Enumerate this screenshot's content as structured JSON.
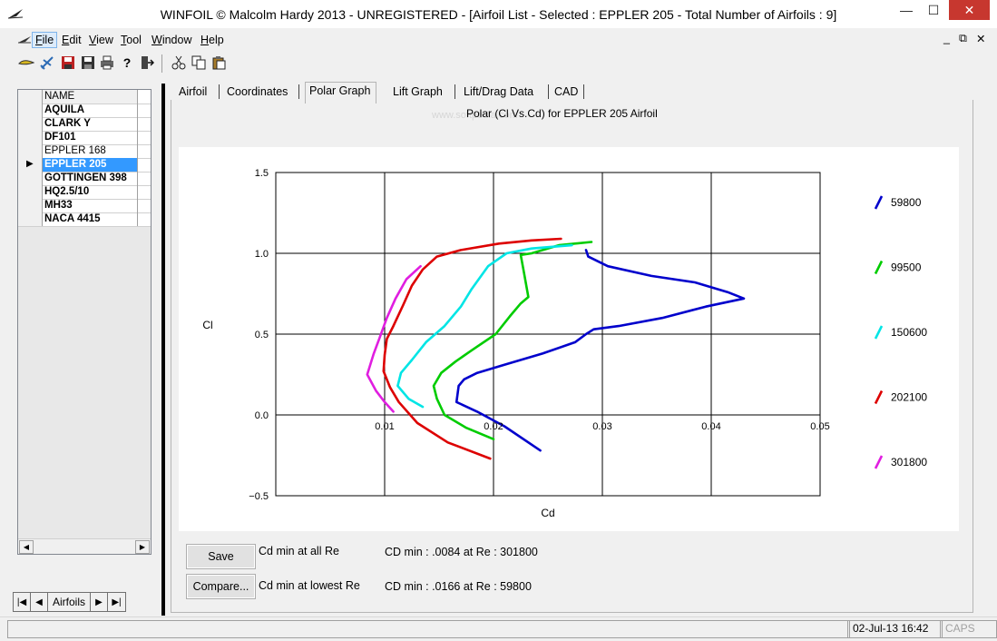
{
  "window": {
    "title": "WINFOIL © Malcolm Hardy 2013 - UNREGISTERED - [Airfoil List - Selected : EPPLER 205 - Total Number of Airfoils : 9]",
    "minimize": "—",
    "maximize": "☐",
    "close": "✕",
    "mdi_minimize": "_",
    "mdi_restore": "⧉",
    "mdi_close": "✕"
  },
  "menu": [
    {
      "label": "File",
      "key": "F"
    },
    {
      "label": "Edit",
      "key": "E"
    },
    {
      "label": "View",
      "key": "V"
    },
    {
      "label": "Tool",
      "key": "T"
    },
    {
      "label": "Window",
      "key": "W"
    },
    {
      "label": "Help",
      "key": "H"
    }
  ],
  "toolbar_icons": [
    "airfoil-icon",
    "aircraft-icon",
    "save-icon",
    "save-as-icon",
    "print-icon",
    "help-icon",
    "exit-icon",
    "cut-icon",
    "copy-icon",
    "paste-icon"
  ],
  "airfoil_list": {
    "header": "NAME",
    "items": [
      "AQUILA",
      "CLARK Y",
      "DF101",
      "EPPLER 168",
      "EPPLER 205",
      "GOTTINGEN 398",
      "HQ2.5/10",
      "MH33",
      "NACA 4415"
    ],
    "selected": "EPPLER 205",
    "selected_marker": "▶",
    "scroll_left": "◀",
    "scroll_right": "▶"
  },
  "navigator": {
    "first": "|◀",
    "prev": "◀",
    "label": "Airfoils",
    "next": "▶",
    "last": "▶|"
  },
  "tabs": [
    "Airfoil",
    "Coordinates",
    "Polar Graph",
    "Lift Graph",
    "Lift/Drag Data",
    "CAD"
  ],
  "active_tab": "Polar Graph",
  "watermark": "www.softpedia.com",
  "chart_data": {
    "type": "line",
    "title": "Polar (Cl Vs.Cd)  for EPPLER 205 Airfoil",
    "xlabel": "Cd",
    "ylabel": "Cl",
    "xlim": [
      0,
      0.05
    ],
    "ylim": [
      -0.5,
      1.5
    ],
    "xticks": [
      "0.01",
      "0.02",
      "0.03",
      "0.04",
      "0.05"
    ],
    "yticks": [
      "1.5",
      "1.0",
      "0.5",
      "0.0",
      "−0.5"
    ],
    "xtick_values": [
      0.01,
      0.02,
      0.03,
      0.04,
      0.05
    ],
    "ytick_values": [
      1.5,
      1.0,
      0.5,
      0.0,
      -0.5
    ],
    "grid": true,
    "legend_position": "right",
    "series": [
      {
        "name": "59800",
        "color": "#0000cc",
        "points": [
          [
            0.0285,
            1.02
          ],
          [
            0.0287,
            0.98
          ],
          [
            0.0305,
            0.92
          ],
          [
            0.0345,
            0.86
          ],
          [
            0.0385,
            0.82
          ],
          [
            0.0415,
            0.76
          ],
          [
            0.043,
            0.72
          ],
          [
            0.0395,
            0.67
          ],
          [
            0.0355,
            0.6
          ],
          [
            0.0315,
            0.55
          ],
          [
            0.0292,
            0.53
          ],
          [
            0.0285,
            0.5
          ],
          [
            0.0275,
            0.45
          ],
          [
            0.0245,
            0.38
          ],
          [
            0.021,
            0.31
          ],
          [
            0.0185,
            0.26
          ],
          [
            0.0173,
            0.22
          ],
          [
            0.0168,
            0.18
          ],
          [
            0.0166,
            0.08
          ],
          [
            0.0185,
            0.02
          ],
          [
            0.021,
            -0.07
          ],
          [
            0.0243,
            -0.22
          ]
        ]
      },
      {
        "name": "99500",
        "color": "#00cc00",
        "points": [
          [
            0.029,
            1.07
          ],
          [
            0.026,
            1.05
          ],
          [
            0.0235,
            1.0
          ],
          [
            0.0225,
            0.99
          ],
          [
            0.0228,
            0.88
          ],
          [
            0.0232,
            0.73
          ],
          [
            0.0225,
            0.69
          ],
          [
            0.0215,
            0.61
          ],
          [
            0.0202,
            0.5
          ],
          [
            0.018,
            0.4
          ],
          [
            0.0165,
            0.33
          ],
          [
            0.0152,
            0.26
          ],
          [
            0.0145,
            0.18
          ],
          [
            0.0148,
            0.1
          ],
          [
            0.0155,
            0.0
          ],
          [
            0.0175,
            -0.08
          ],
          [
            0.02,
            -0.15
          ]
        ]
      },
      {
        "name": "150600",
        "color": "#00e5e5",
        "points": [
          [
            0.0272,
            1.05
          ],
          [
            0.0235,
            1.03
          ],
          [
            0.0212,
            1.0
          ],
          [
            0.0195,
            0.92
          ],
          [
            0.018,
            0.78
          ],
          [
            0.017,
            0.67
          ],
          [
            0.0155,
            0.55
          ],
          [
            0.0138,
            0.45
          ],
          [
            0.0125,
            0.34
          ],
          [
            0.0115,
            0.26
          ],
          [
            0.0112,
            0.18
          ],
          [
            0.0122,
            0.1
          ],
          [
            0.0135,
            0.05
          ]
        ]
      },
      {
        "name": "202100",
        "color": "#dd0000",
        "points": [
          [
            0.0262,
            1.09
          ],
          [
            0.0235,
            1.08
          ],
          [
            0.0205,
            1.06
          ],
          [
            0.017,
            1.02
          ],
          [
            0.0148,
            0.98
          ],
          [
            0.0135,
            0.9
          ],
          [
            0.0125,
            0.8
          ],
          [
            0.0117,
            0.68
          ],
          [
            0.0108,
            0.55
          ],
          [
            0.0102,
            0.47
          ],
          [
            0.01,
            0.37
          ],
          [
            0.0099,
            0.27
          ],
          [
            0.0105,
            0.17
          ],
          [
            0.0113,
            0.08
          ],
          [
            0.013,
            -0.05
          ],
          [
            0.0158,
            -0.17
          ],
          [
            0.0197,
            -0.27
          ]
        ]
      },
      {
        "name": "301800",
        "color": "#e01ee0",
        "points": [
          [
            0.0133,
            0.92
          ],
          [
            0.012,
            0.84
          ],
          [
            0.011,
            0.72
          ],
          [
            0.0102,
            0.6
          ],
          [
            0.0095,
            0.47
          ],
          [
            0.009,
            0.38
          ],
          [
            0.0084,
            0.25
          ],
          [
            0.0092,
            0.15
          ],
          [
            0.01,
            0.08
          ],
          [
            0.0108,
            0.02
          ]
        ]
      }
    ]
  },
  "actions": {
    "save": "Save",
    "compare": "Compare..."
  },
  "results": {
    "all_re_label": "Cd min at all Re",
    "all_re_value": "CD min :  .0084 at Re :  301800",
    "lowest_re_label": "Cd min at lowest Re",
    "lowest_re_value": "CD min :  .0166 at Re :  59800"
  },
  "status": {
    "datetime": "02-Jul-13 16:42",
    "caps": "CAPS"
  }
}
